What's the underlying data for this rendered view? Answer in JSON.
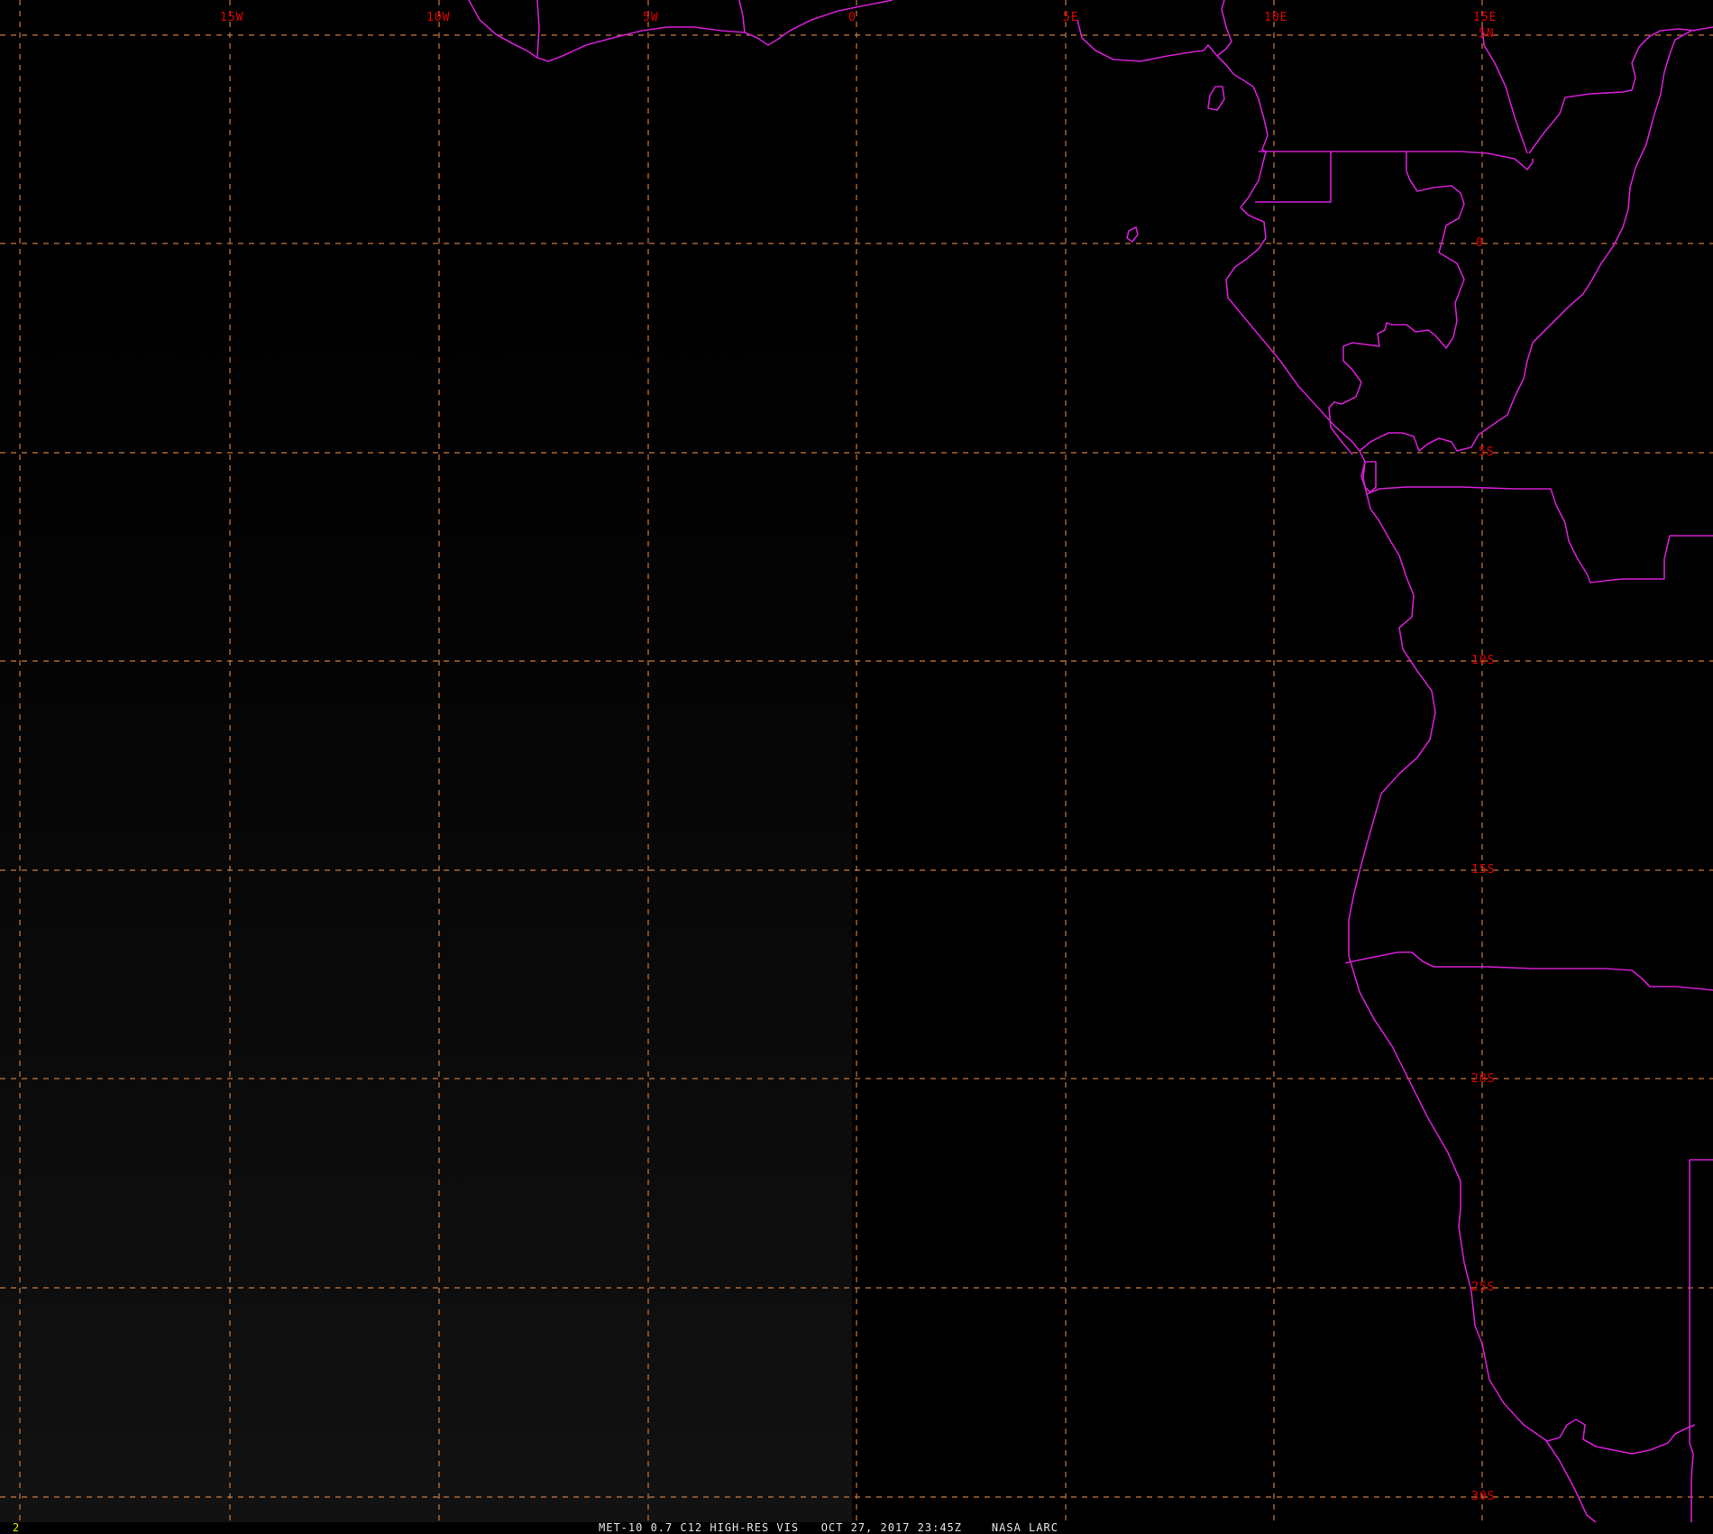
{
  "map": {
    "colors": {
      "background": "#000000",
      "gridline": "#c8783c",
      "coastline": "#d21ed2",
      "grid_label": "#e00000",
      "frame_number": "#e8e800",
      "caption": "#e6e6e6"
    },
    "longitude_labels": [
      "15W",
      "10W",
      "5W",
      "0",
      "5E",
      "10E",
      "15E"
    ],
    "latitude_labels": [
      "5N",
      "0",
      "5S",
      "10S",
      "15S",
      "20S",
      "25S",
      "30S"
    ]
  },
  "footer": {
    "frame_number": "2",
    "caption": "MET-10 0.7 C12 HIGH-RES VIS   OCT 27, 2017 23:45Z    NASA LARC"
  }
}
